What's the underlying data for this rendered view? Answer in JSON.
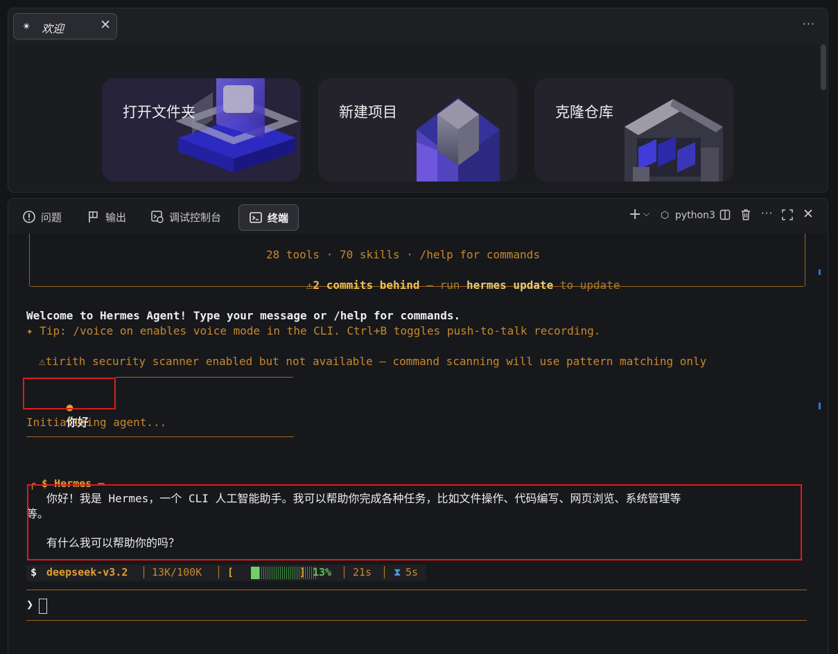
{
  "welcome": {
    "tab_label": "欢迎",
    "more_icon": "more-icon",
    "cards": [
      {
        "label": "打开文件夹",
        "icon": "folder-3d-icon"
      },
      {
        "label": "新建项目",
        "icon": "cube-3d-icon"
      },
      {
        "label": "克隆仓库",
        "icon": "repository-3d-icon"
      }
    ]
  },
  "panel": {
    "tabs": [
      {
        "label": "问题",
        "icon": "problems-icon"
      },
      {
        "label": "输出",
        "icon": "output-icon"
      },
      {
        "label": "调试控制台",
        "icon": "debug-console-icon"
      },
      {
        "label": "终端",
        "icon": "terminal-icon",
        "active": true
      }
    ],
    "shell_name": "python3"
  },
  "terminal": {
    "banner_tools": "28 tools · 70 skills · /help for commands",
    "banner_warn_prefix": "⚠",
    "banner_warn_bold": "2 commits behind",
    "banner_warn_mid": " — run ",
    "banner_warn_cmd": "hermes update",
    "banner_warn_end": " to update",
    "welcome_text": "Welcome to Hermes Agent! Type your message or /help for commands.",
    "tip_text": "✦ Tip: /voice on enables voice mode in the CLI. Ctrl+B toggles push-to-talk recording.",
    "tirith_text": "⚠tirith security scanner enabled but not available — command scanning will use pattern matching only",
    "user_bullet": "●",
    "user_message": "你好",
    "initializing_text": "Initializing agent...",
    "hermes_header": "╭ $ Hermes ─",
    "reply_line1": "   你好！我是 Hermes，一个 CLI 人工智能助手。我可以帮助你完成各种任务，比如文件操作、代码编写、网页浏览、系统管理等",
    "reply_line2": "等。",
    "reply_line3": "   有什么我可以帮助你的吗？",
    "status": {
      "model_prefix": "$ ",
      "model": "deepseek-v3.2",
      "sep": "│",
      "tokens": "13K/100K",
      "bracket_open": "[",
      "bracket_close": "]",
      "percent": "13%",
      "progress": 0.13,
      "elapsed": "21s",
      "timer_icon": "hourglass-icon",
      "timer": "5s"
    },
    "prompt_glyph": "❯"
  },
  "colors": {
    "accent_orange": "#c8882c",
    "highlight_red": "#e01b1b",
    "progress_green": "#6fd06a"
  }
}
